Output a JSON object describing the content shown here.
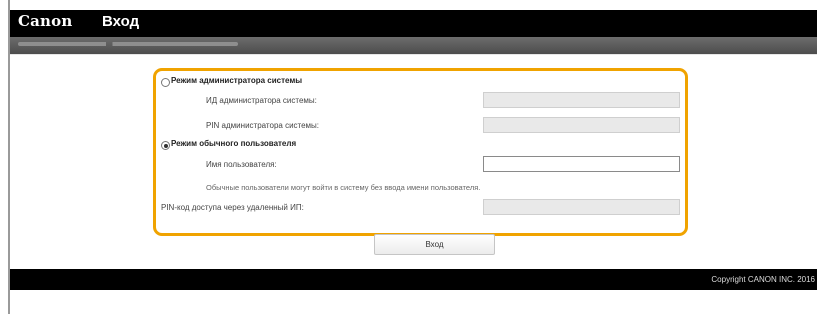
{
  "header": {
    "logo": "Canon",
    "title": "Вход",
    "breadcrumb": "████ ████ ████"
  },
  "login": {
    "admin_mode_label": "Режим администратора системы",
    "admin_id_label": "ИД администратора системы:",
    "admin_id_value": "",
    "admin_pin_label": "PIN администратора системы:",
    "admin_pin_value": "",
    "user_mode_label": "Режим обычного пользователя",
    "user_mode_selected": true,
    "username_label": "Имя пользователя:",
    "username_value": "",
    "user_hint": "Обычные пользователи могут войти в систему без ввода имени пользователя.",
    "remote_pin_label": "PIN-код доступа через удаленный ИП:",
    "remote_pin_value": "",
    "submit_label": "Вход"
  },
  "footer": {
    "copyright": "Copyright CANON INC. 2016"
  },
  "colors": {
    "accent_border": "#f0a300",
    "topbar": "#000000",
    "subbar": "#5a5a5a"
  }
}
